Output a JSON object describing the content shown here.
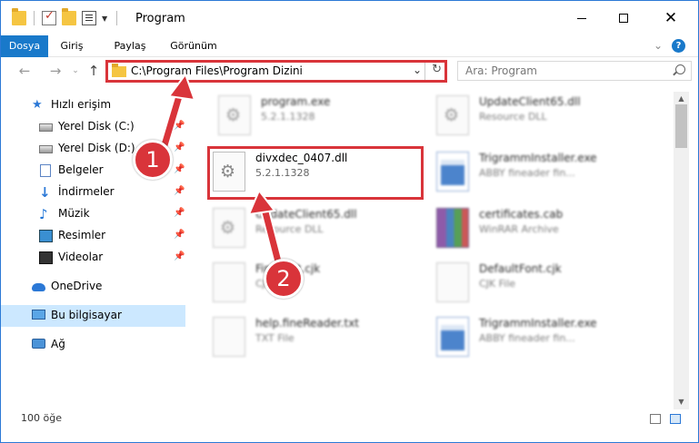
{
  "window": {
    "title": "Program",
    "controls": {
      "minimize": "—",
      "maximize": "☐",
      "close": "✕"
    }
  },
  "ribbon": {
    "tabs": [
      "Dosya",
      "Giriş",
      "Paylaş",
      "Görünüm"
    ],
    "expand_glyph": "⌄",
    "help_glyph": "?"
  },
  "nav": {
    "back_glyph": "←",
    "forward_glyph": "→",
    "recent_glyph": "⌄",
    "up_glyph": "↑",
    "address_path": "C:\\Program Files\\Program Dizini",
    "address_dropdown_glyph": "⌄",
    "refresh_glyph": "↻",
    "search_placeholder": "Ara: Program"
  },
  "sidebar": {
    "items": [
      {
        "label": "Hızlı erişim",
        "icon": "star-icon"
      },
      {
        "label": "Yerel Disk (C:)",
        "icon": "disk-icon",
        "pinned": true
      },
      {
        "label": "Yerel Disk (D:)",
        "icon": "disk-icon",
        "pinned": true
      },
      {
        "label": "Belgeler",
        "icon": "documents-icon",
        "pinned": true
      },
      {
        "label": "İndirmeler",
        "icon": "download-icon",
        "pinned": true
      },
      {
        "label": "Müzik",
        "icon": "music-icon",
        "pinned": true
      },
      {
        "label": "Resimler",
        "icon": "pictures-icon",
        "pinned": true
      },
      {
        "label": "Videolar",
        "icon": "videos-icon",
        "pinned": true
      },
      {
        "label": "OneDrive",
        "icon": "cloud-icon"
      },
      {
        "label": "Bu bilgisayar",
        "icon": "computer-icon",
        "selected": true
      },
      {
        "label": "Ağ",
        "icon": "network-icon"
      }
    ],
    "pin_glyph": "📌"
  },
  "files": [
    {
      "name": "program.exe",
      "sub": "5.2.1.1328",
      "icon": "gear"
    },
    {
      "name": "UpdateClient65.dll",
      "sub": "Resource DLL",
      "icon": "gear"
    },
    {
      "name": "divxdec_0407.dll",
      "sub": "5.2.1.1328",
      "icon": "gear",
      "highlight": true
    },
    {
      "name": "TrigrammInstaller.exe",
      "sub": "ABBY fineader fin...",
      "icon": "exe"
    },
    {
      "name": "UpdateClient65.dll",
      "sub": "Resource DLL",
      "icon": "gear"
    },
    {
      "name": "certificates.cab",
      "sub": "WinRAR Archive",
      "icon": "rar"
    },
    {
      "name": "FineFont.cjk",
      "sub": "CJK File",
      "icon": "blank"
    },
    {
      "name": "DefaultFont.cjk",
      "sub": "CJK File",
      "icon": "blank"
    },
    {
      "name": "help.fineReader.txt",
      "sub": "TXT File",
      "icon": "blank"
    },
    {
      "name": "TrigrammInstaller.exe",
      "sub": "ABBY fineader fin...",
      "icon": "exe"
    }
  ],
  "scrollbar": {
    "up_glyph": "▲",
    "down_glyph": "▼"
  },
  "status": {
    "item_count": "100 öğe"
  },
  "annotations": {
    "step1": "1",
    "step2": "2"
  },
  "colors": {
    "accent": "#1979ca",
    "highlight": "#d9343a",
    "selection": "#cce8ff"
  }
}
